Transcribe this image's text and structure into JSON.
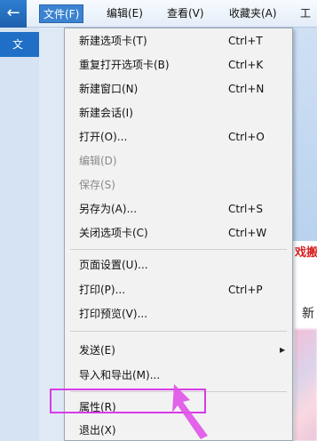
{
  "menubar": {
    "back_icon": "back-arrow-icon",
    "items": [
      {
        "label": "文件(F)"
      },
      {
        "label": "编辑(E)"
      },
      {
        "label": "查看(V)"
      },
      {
        "label": "收藏夹(A)"
      },
      {
        "label": "工"
      }
    ]
  },
  "left_tab": {
    "label": "文"
  },
  "right_peek": {
    "red_text": "戏搬",
    "new_text": "新"
  },
  "file_menu": {
    "items": [
      {
        "label": "新建选项卡(T)",
        "shortcut": "Ctrl+T"
      },
      {
        "label": "重复打开选项卡(B)",
        "shortcut": "Ctrl+K"
      },
      {
        "label": "新建窗口(N)",
        "shortcut": "Ctrl+N"
      },
      {
        "label": "新建会话(I)",
        "shortcut": ""
      },
      {
        "label": "打开(O)...",
        "shortcut": "Ctrl+O"
      },
      {
        "label": "编辑(D)",
        "shortcut": ""
      },
      {
        "label": "保存(S)",
        "shortcut": ""
      },
      {
        "label": "另存为(A)...",
        "shortcut": "Ctrl+S"
      },
      {
        "label": "关闭选项卡(C)",
        "shortcut": "Ctrl+W"
      },
      {
        "label": "页面设置(U)...",
        "shortcut": ""
      },
      {
        "label": "打印(P)...",
        "shortcut": "Ctrl+P"
      },
      {
        "label": "打印预览(V)...",
        "shortcut": ""
      },
      {
        "label": "发送(E)",
        "shortcut": ""
      },
      {
        "label": "导入和导出(M)...",
        "shortcut": ""
      },
      {
        "label": "属性(R)",
        "shortcut": ""
      },
      {
        "label": "退出(X)",
        "shortcut": ""
      }
    ]
  },
  "colors": {
    "menu_active": "#3b83d1",
    "highlight_border": "#d83be8",
    "pointer": "#e052e8"
  }
}
